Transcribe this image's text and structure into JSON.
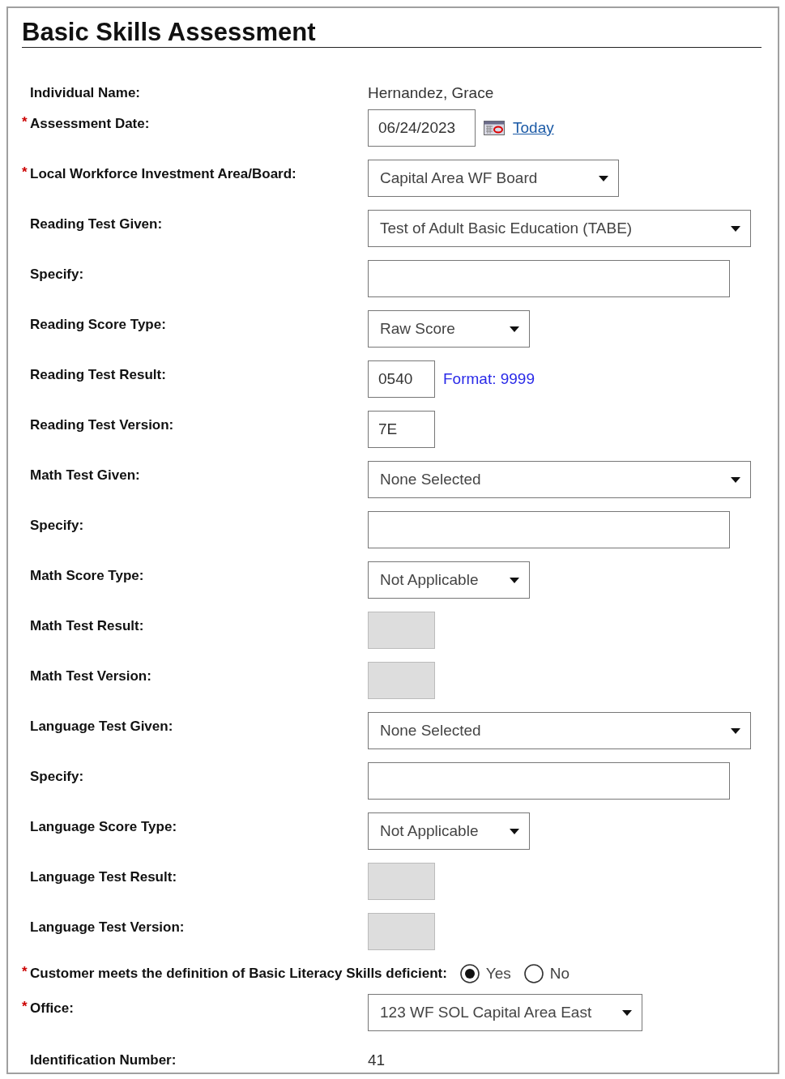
{
  "title": "Basic Skills Assessment",
  "fields": [
    {
      "kind": "text",
      "label": "Individual Name:",
      "value": "Hernandez, Grace"
    },
    {
      "kind": "date",
      "label": "Assessment Date:",
      "mark": "*",
      "value": "06/24/2023",
      "link": "Today"
    },
    {
      "kind": "select",
      "label": "Local Workforce Investment Area/Board:",
      "mark": "*",
      "value": "Capital Area WF Board"
    },
    {
      "kind": "select",
      "label": "Reading Test Given:",
      "value": "Test of Adult Basic Education (TABE)"
    },
    {
      "kind": "input",
      "label": "Specify:",
      "disabled": false
    },
    {
      "kind": "select",
      "label": "Reading Score Type:",
      "value": "Raw Score"
    },
    {
      "kind": "input",
      "label": "Reading Test Result:",
      "disabled": false,
      "value": "0540",
      "hint": "Format: 9999"
    },
    {
      "kind": "input",
      "label": "Reading Test Version:",
      "disabled": false,
      "value": "7E"
    },
    {
      "kind": "select",
      "label": "Math Test Given:",
      "value": "None Selected"
    },
    {
      "kind": "input",
      "label": "Specify:",
      "disabled": false
    },
    {
      "kind": "select",
      "label": "Math Score Type:",
      "value": "Not Applicable"
    },
    {
      "kind": "input",
      "label": "Math Test Result:",
      "disabled": true
    },
    {
      "kind": "input",
      "label": "Math Test Version:",
      "disabled": true
    },
    {
      "kind": "select",
      "label": "Language Test Given:",
      "value": "None Selected"
    },
    {
      "kind": "input",
      "label": "Specify:",
      "disabled": false
    },
    {
      "kind": "select",
      "label": "Language Score Type:",
      "value": "Not Applicable"
    },
    {
      "kind": "input",
      "label": "Language Test Result:",
      "disabled": true
    },
    {
      "kind": "input",
      "label": "Language Test Version:",
      "disabled": true
    },
    {
      "kind": "radio",
      "label": "Customer meets the definition of Basic Literacy Skills deficient:",
      "mark": "*",
      "options": [
        {
          "label": "Yes",
          "selected": true
        },
        {
          "label": "No",
          "selected": false
        }
      ]
    },
    {
      "kind": "select",
      "label": "Office:",
      "mark": "*",
      "value": "123 WF SOL Capital Area East"
    },
    {
      "kind": "text",
      "label": "Identification Number:",
      "value": "41"
    }
  ]
}
